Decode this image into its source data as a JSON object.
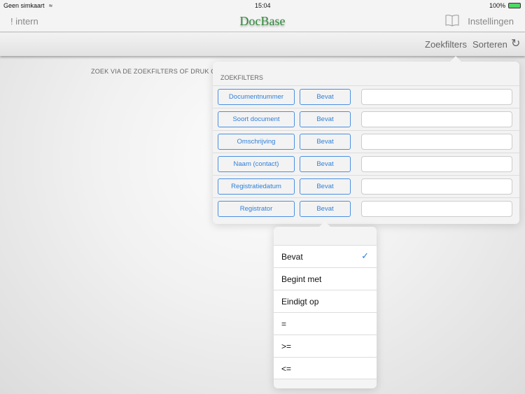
{
  "status": {
    "carrier": "Geen simkaart",
    "time": "15:04",
    "battery": "100%"
  },
  "navbar": {
    "left": "! intern",
    "title": "DocBase",
    "settings": "Instellingen"
  },
  "toolbar": {
    "filters": "Zoekfilters",
    "sort": "Sorteren"
  },
  "hint": "ZOEK VIA DE ZOEKFILTERS OF DRUK O",
  "filters": {
    "title": "ZOEKFILTERS",
    "rows": [
      {
        "field": "Documentnummer",
        "operator": "Bevat",
        "value": ""
      },
      {
        "field": "Soort document",
        "operator": "Bevat",
        "value": ""
      },
      {
        "field": "Omschrijving",
        "operator": "Bevat",
        "value": ""
      },
      {
        "field": "Naam (contact)",
        "operator": "Bevat",
        "value": ""
      },
      {
        "field": "Registratiedatum",
        "operator": "Bevat",
        "value": ""
      },
      {
        "field": "Registrator",
        "operator": "Bevat",
        "value": ""
      }
    ]
  },
  "operator_menu": {
    "selected": "Bevat",
    "options": [
      "Bevat",
      "Begint met",
      "Eindigt op",
      "=",
      ">=",
      "<="
    ]
  },
  "colors": {
    "accent": "#2f7fd8",
    "logo": "#2e8b3a"
  }
}
